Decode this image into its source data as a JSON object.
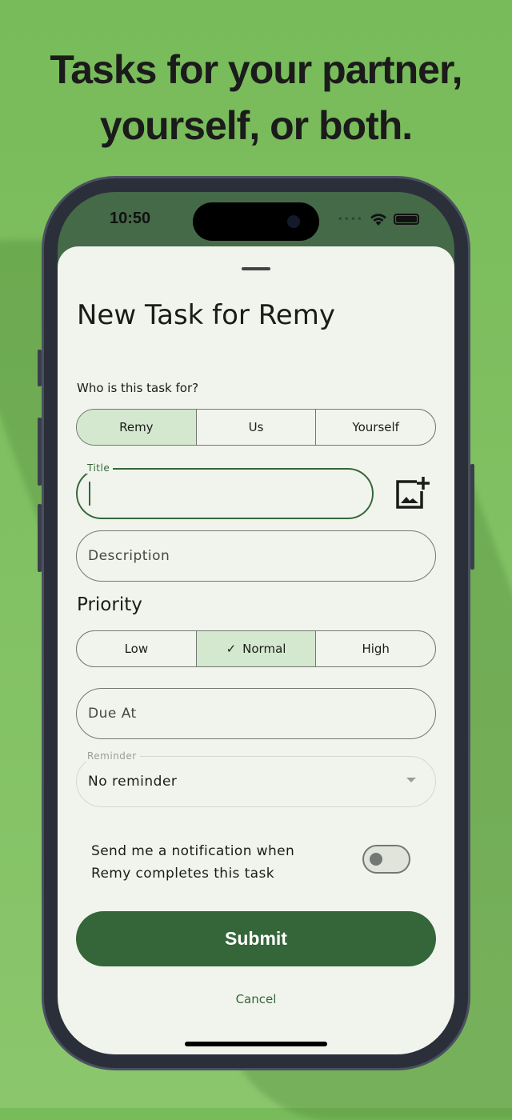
{
  "headline": {
    "line1": "Tasks for your partner,",
    "line2": "yourself, or both."
  },
  "status_bar": {
    "time": "10:50",
    "signal_icon": "signal-dots-icon",
    "wifi_icon": "wifi-icon",
    "battery_icon": "battery-icon"
  },
  "sheet": {
    "title": "New Task for Remy",
    "assignee": {
      "label": "Who is this task for?",
      "options": [
        "Remy",
        "Us",
        "Yourself"
      ],
      "selected": "Remy"
    },
    "title_field": {
      "label": "Title",
      "value": ""
    },
    "add_image_icon": "add-photo-icon",
    "description": {
      "placeholder": "Description"
    },
    "priority": {
      "label": "Priority",
      "options": [
        "Low",
        "Normal",
        "High"
      ],
      "selected": "Normal"
    },
    "due_at": {
      "placeholder": "Due At"
    },
    "reminder": {
      "label": "Reminder",
      "value": "No reminder"
    },
    "notify": {
      "line1": "Send me a notification when",
      "line2": "Remy completes this task",
      "enabled": false
    },
    "submit_label": "Submit",
    "cancel_label": "Cancel"
  },
  "colors": {
    "accent": "#356639",
    "selected_segment": "#d3e8ce",
    "background": "#7bbd5c",
    "sheet": "#f1f4ec"
  }
}
